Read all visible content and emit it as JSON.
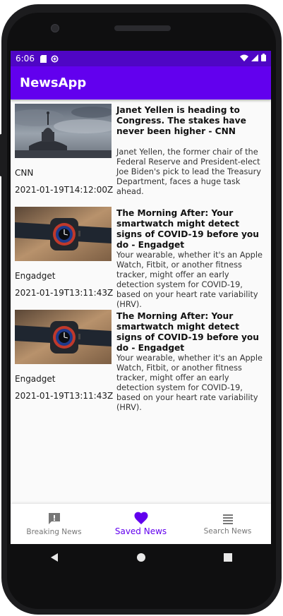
{
  "status": {
    "time": "6:06"
  },
  "app_bar": {
    "title": "NewsApp"
  },
  "articles": [
    {
      "source": "CNN",
      "date": "2021-01-19T14:12:00Z",
      "title": "Janet Yellen is heading to Congress. The stakes have never been higher - CNN",
      "description": "Janet Yellen, the former chair of the Federal Reserve and President-elect Joe Biden's pick to lead the Treasury Department, faces a huge task ahead.",
      "image_icon": "capitol-dome-image"
    },
    {
      "source": "Engadget",
      "date": "2021-01-19T13:11:43Z",
      "title": "The Morning After: Your smartwatch might detect signs of COVID-19 before you do - Engadget",
      "description": "Your wearable, whether it's an Apple Watch, Fitbit, or another fitness tracker, might offer an early detection system for COVID-19, based on your heart rate variability (HRV).",
      "image_icon": "smartwatch-image"
    },
    {
      "source": "Engadget",
      "date": "2021-01-19T13:11:43Z",
      "title": "The Morning After: Your smartwatch might detect signs of COVID-19 before you do - Engadget",
      "description": "Your wearable, whether it's an Apple Watch, Fitbit, or another fitness tracker, might offer an early detection system for COVID-19, based on your heart rate variability (HRV).",
      "image_icon": "smartwatch-image"
    }
  ],
  "bottom_nav": {
    "items": [
      {
        "label": "Breaking News",
        "icon": "feedback-icon",
        "active": false
      },
      {
        "label": "Saved News",
        "icon": "heart-icon",
        "active": true
      },
      {
        "label": "Search News",
        "icon": "list-icon",
        "active": false
      }
    ]
  },
  "colors": {
    "primary": "#6200ee",
    "status_bar": "#4f06c4",
    "inactive": "#777777"
  }
}
